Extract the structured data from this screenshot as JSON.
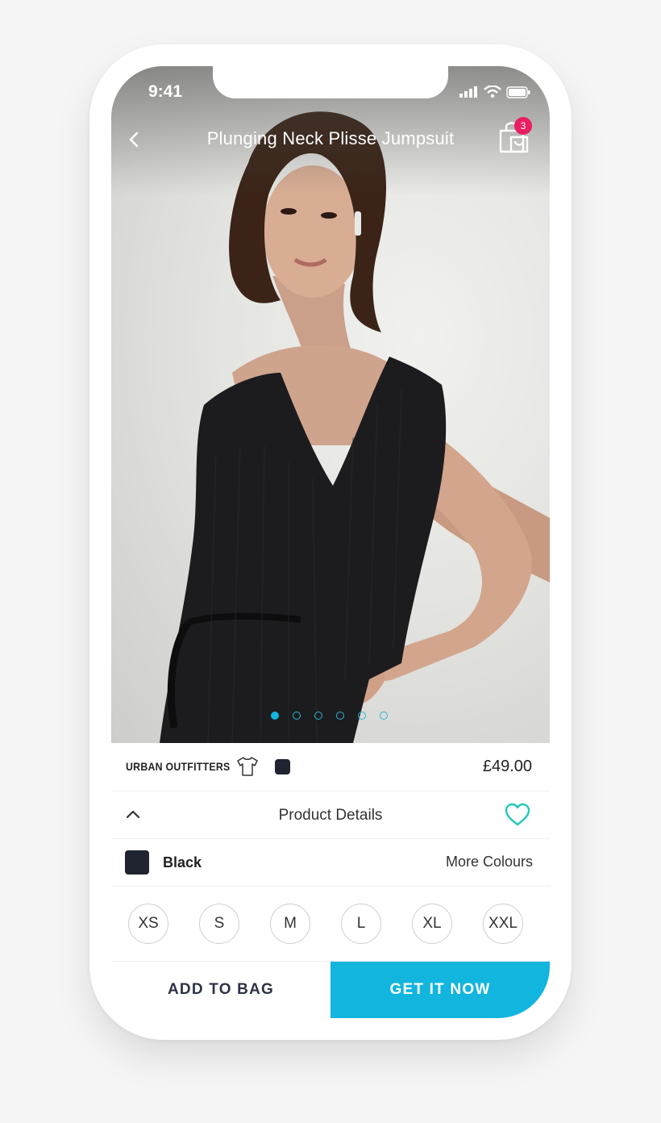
{
  "status_bar": {
    "time": "9:41"
  },
  "nav": {
    "title": "Plunging Neck Plisse Jumpsuit",
    "back_icon": "chevron-left-icon",
    "bag_icon": "shopping-bag-icon",
    "bag_count": "3"
  },
  "gallery": {
    "image": "model-wearing-black-jumpsuit-photo",
    "total_images": 6,
    "current_index": 1
  },
  "product": {
    "brand": "URBAN OUTFITTERS",
    "category_icon": "tshirt-icon",
    "price": "£49.00"
  },
  "details": {
    "title": "Product Details",
    "expanded": true
  },
  "colour": {
    "name": "Black",
    "swatch": "#1f2430",
    "more_label": "More Colours"
  },
  "sizes": [
    "XS",
    "S",
    "M",
    "L",
    "XL",
    "XXL"
  ],
  "actions": {
    "add_to_bag": "ADD TO BAG",
    "get_it_now": "GET IT NOW"
  },
  "colors": {
    "accent": "#12b5de",
    "badge": "#e91e63",
    "heart": "#22c9b5",
    "text_dark": "#2c3344"
  }
}
